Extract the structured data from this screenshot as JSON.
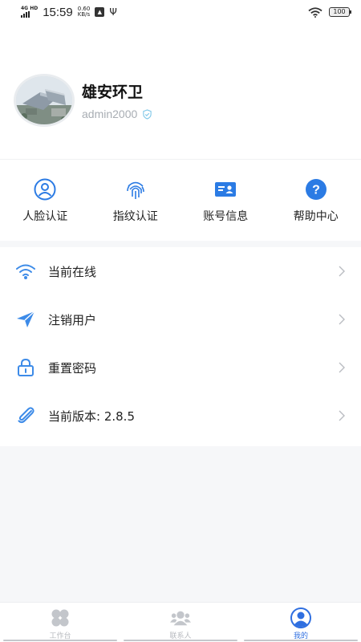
{
  "status_bar": {
    "network_label": "4G HD",
    "time": "15:59",
    "net_speed_value": "0.60",
    "net_speed_unit": "KB/s",
    "battery": "100",
    "icons": [
      "signal-icon",
      "notification-icon",
      "usb-icon",
      "wifi-icon",
      "battery-icon"
    ]
  },
  "profile": {
    "company_name": "雄安环卫",
    "username": "admin2000",
    "avatar_icon": "building-photo",
    "verified_icon": "verified-check-icon"
  },
  "quick_actions": [
    {
      "label": "人脸认证",
      "icon": "face-id-icon"
    },
    {
      "label": "指纹认证",
      "icon": "fingerprint-icon"
    },
    {
      "label": "账号信息",
      "icon": "id-card-icon"
    },
    {
      "label": "帮助中心",
      "icon": "help-icon"
    }
  ],
  "menu": [
    {
      "label": "当前在线",
      "icon": "wifi-icon"
    },
    {
      "label": "注销用户",
      "icon": "paper-plane-icon"
    },
    {
      "label": "重置密码",
      "icon": "lock-icon"
    },
    {
      "label": "当前版本: 2.8.5",
      "icon": "paperclip-icon"
    }
  ],
  "tabbar": {
    "tabs": [
      {
        "label": "工作台",
        "icon": "grid-clover-icon",
        "active": false
      },
      {
        "label": "联系人",
        "icon": "contacts-icon",
        "active": false
      },
      {
        "label": "我的",
        "icon": "profile-icon",
        "active": true
      }
    ]
  },
  "colors": {
    "accent": "#2f6fe0",
    "icon_blue": "#2b7be4",
    "menu_icon_blue": "#3d8be8",
    "muted_text": "#a8adb3",
    "background": "#f6f7f9"
  }
}
